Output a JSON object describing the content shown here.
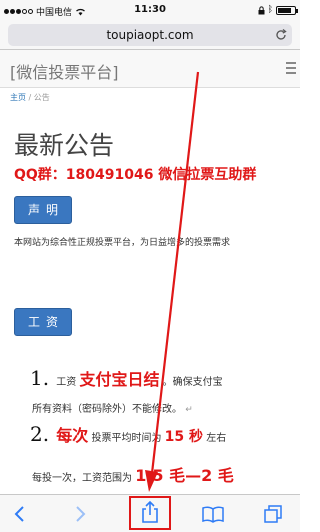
{
  "status_bar": {
    "carrier": "中国电信",
    "time": "11:30",
    "colors": {
      "bg": "#f7f7f7"
    }
  },
  "browser": {
    "url": "toupiaopt.com",
    "icons": [
      "wifi-icon",
      "lock-icon",
      "bluetooth-icon",
      "battery-icon",
      "reload-icon"
    ]
  },
  "page": {
    "site_title": "[微信投票平台]",
    "breadcrumb": {
      "home": "主页",
      "sep": "/",
      "current": "公告"
    },
    "heading": "最新公告",
    "qq_line": "QQ群：180491046 微信拉票互助群",
    "statement_button": "声明",
    "description": "本网站为综合性正规投票平台，为日益增多的投票需求",
    "wage_button": "工资",
    "items": [
      {
        "num": "1.",
        "line1_a": "工资",
        "line1_b": "支付宝日结",
        "line1_c": "。确保支付宝",
        "line2": "所有资料（密码除外）不能修改。",
        "line2_mark": "↵"
      },
      {
        "num": "2.",
        "line1_a": "每次",
        "line1_b": "投票平均时间为",
        "line1_c": "15 秒",
        "line1_d": "左右",
        "line2_a": "每投一次，工资范围为",
        "line2_b": "1.5 毛—2 毛"
      }
    ],
    "colors": {
      "accent_red": "#e01818",
      "button_blue": "#3a77c0"
    }
  },
  "toolbar": {
    "buttons": [
      "back-icon",
      "forward-icon",
      "share-icon",
      "bookmarks-icon",
      "tabs-icon"
    ]
  }
}
